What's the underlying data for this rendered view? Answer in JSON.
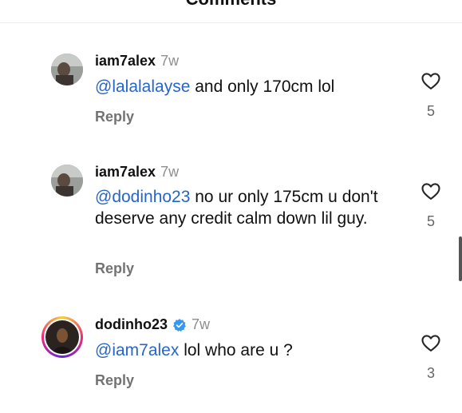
{
  "sheet": {
    "title": "Comments"
  },
  "comments": [
    {
      "username": "iam7alex",
      "time": "7w",
      "mention": "@lalalalayse",
      "text": " and only 170cm lol",
      "reply_label": "Reply",
      "likes": "5",
      "verified": false
    },
    {
      "username": "iam7alex",
      "time": "7w",
      "mention": "@dodinho23",
      "text": " no ur only 175cm u don't deserve any credit calm down lil guy.",
      "reply_label": "Reply",
      "likes": "5",
      "verified": false
    },
    {
      "username": "dodinho23",
      "time": "7w",
      "mention": "@iam7alex",
      "text": " lol who are u ?",
      "reply_label": "Reply",
      "likes": "3",
      "verified": true
    }
  ],
  "icons": {
    "like": "heart-outline-icon",
    "verified": "verified-badge-icon"
  },
  "colors": {
    "mention": "#2765c8",
    "verified": "#3897f0",
    "story_ring": [
      "#f9ce34",
      "#ee2a7b",
      "#6228d7"
    ]
  }
}
